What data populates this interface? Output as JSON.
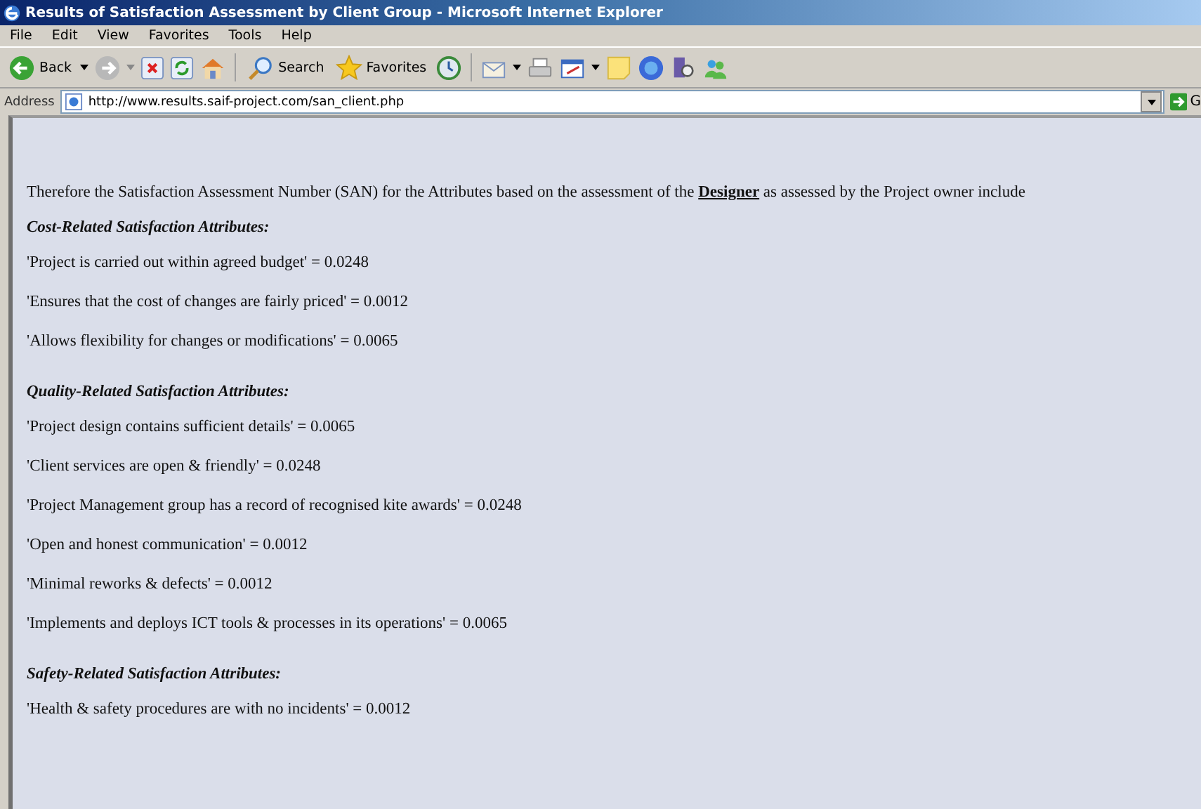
{
  "window": {
    "title": "Results of Satisfaction Assessment by Client Group - Microsoft Internet Explorer"
  },
  "menu": [
    "File",
    "Edit",
    "View",
    "Favorites",
    "Tools",
    "Help"
  ],
  "toolbar": {
    "back": "Back",
    "search": "Search",
    "favorites": "Favorites"
  },
  "address": {
    "label": "Address",
    "value": "http://www.results.saif-project.com/san_client.php",
    "go": "G"
  },
  "intro": "Therefore the Satisfaction Assessment Number (SAN) for the Attributes based on the assessment of the **Designer** as assessed by the Project owner include",
  "sections": [
    {
      "heading": "Cost-Related Satisfaction Attributes:",
      "items": [
        "'Project is carried out within agreed budget' = 0.0248",
        "'Ensures that the cost of changes are fairly priced' = 0.0012",
        "'Allows flexibility for changes or modifications' = 0.0065"
      ]
    },
    {
      "heading": "Quality-Related Satisfaction Attributes:",
      "items": [
        "'Project design contains sufficient details' = 0.0065",
        "'Client services are open & friendly' = 0.0248",
        "'Project Management group has a record of recognised kite awards' = 0.0248",
        "'Open and honest communication' = 0.0012",
        "'Minimal reworks & defects' = 0.0012",
        "'Implements and deploys ICT tools & processes in its operations' = 0.0065"
      ]
    },
    {
      "heading": "Safety-Related Satisfaction Attributes:",
      "items": [
        "'Health & safety procedures are with no incidents' = 0.0012"
      ]
    }
  ]
}
